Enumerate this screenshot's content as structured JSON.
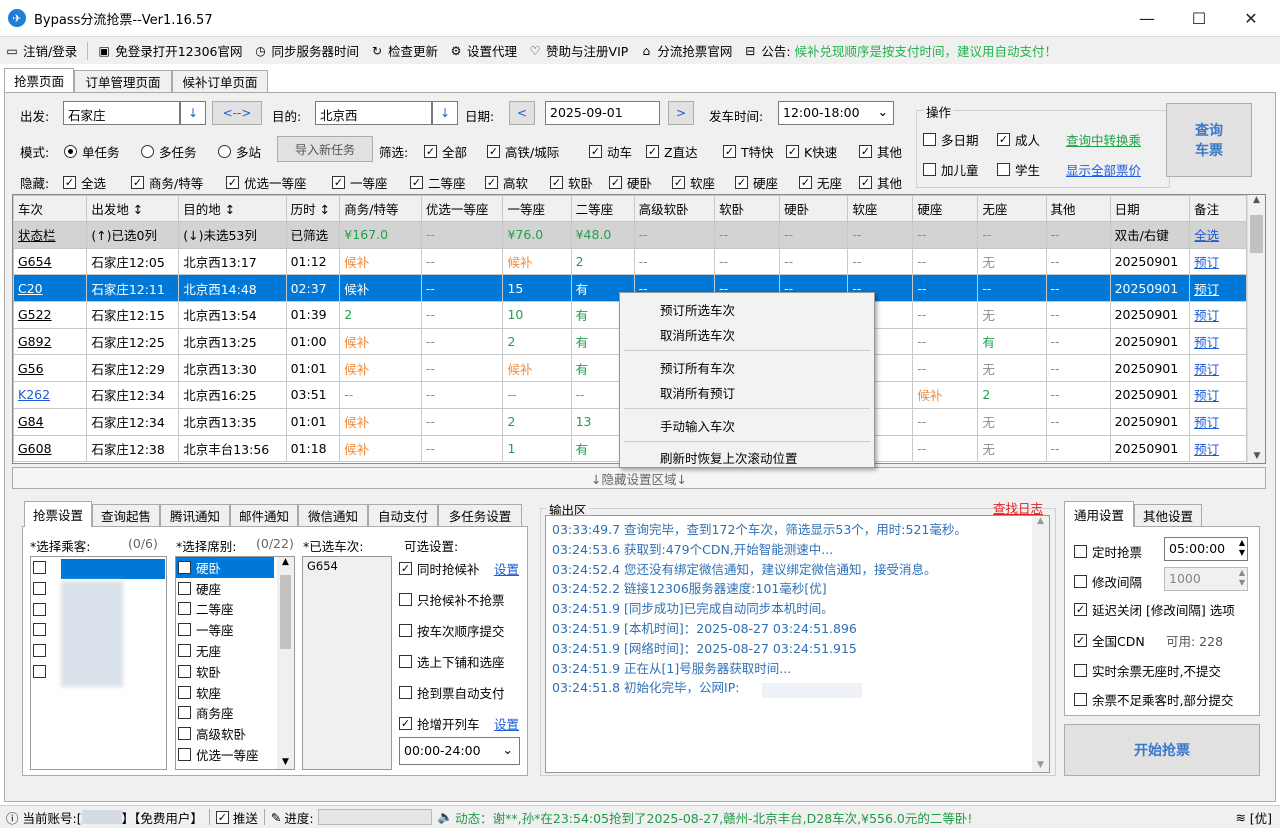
{
  "window": {
    "title": "Bypass分流抢票--Ver1.16.57"
  },
  "toolbar": {
    "items": [
      "注销/登录",
      "免登录打开12306官网",
      "同步服务器时间",
      "检查更新",
      "设置代理",
      "赞助与注册VIP",
      "分流抢票官网",
      "公告:"
    ],
    "notice": "候补兑现顺序是按支付时间，建议用自动支付！"
  },
  "main_tabs": [
    "抢票页面",
    "订单管理页面",
    "候补订单页面"
  ],
  "query": {
    "from_label": "出发:",
    "from_value": "石家庄",
    "swap_label": "<-->",
    "to_label": "目的:",
    "to_value": "北京西",
    "date_label": "日期:",
    "date_value": "2025-09-01",
    "prev": "<",
    "next": ">",
    "time_label": "发车时间:",
    "time_value": "12:00-18:00"
  },
  "ops": {
    "title": "操作",
    "multi_day": "多日期",
    "adult": "成人",
    "add_child": "加儿童",
    "student": "学生",
    "transfer_link": "查询中转换乘",
    "all_price_link": "显示全部票价",
    "query_btn_l1": "查询",
    "query_btn_l2": "车票"
  },
  "mode": {
    "label": "模式:",
    "single": "单任务",
    "multi": "多任务",
    "multi_station": "多站",
    "import_btn": "导入新任务"
  },
  "filter": {
    "label": "筛选:",
    "items": [
      "全部",
      "高铁/城际",
      "动车",
      "Z直达",
      "T特快",
      "K快速",
      "其他"
    ]
  },
  "hide": {
    "label": "隐藏:",
    "items": [
      "全选",
      "商务/特等",
      "优选一等座",
      "一等座",
      "二等座",
      "高软",
      "软卧",
      "硬卧",
      "软座",
      "硬座",
      "无座",
      "其他"
    ]
  },
  "grid": {
    "headers": [
      "车次",
      "出发地 ↕",
      "目的地 ↕",
      "历时 ↕",
      "商务/特等",
      "优选一等座",
      "一等座",
      "二等座",
      "高级软卧",
      "软卧",
      "硬卧",
      "软座",
      "硬座",
      "无座",
      "其他",
      "日期",
      "备注"
    ],
    "status_row": [
      "状态栏",
      "(↑)已选0列",
      "(↓)未选53列",
      "已筛选",
      "¥167.0",
      "--",
      "¥76.0",
      "¥48.0",
      "--",
      "--",
      "--",
      "--",
      "--",
      "--",
      "--",
      "双击/右键",
      "全选"
    ],
    "rows": [
      [
        "G654",
        "石家庄12:05",
        "北京西13:17",
        "01:12",
        "候补",
        "--",
        "候补",
        "2",
        "--",
        "--",
        "--",
        "--",
        "--",
        "无",
        "--",
        "20250901",
        "预订"
      ],
      [
        "C20",
        "石家庄12:11",
        "北京西14:48",
        "02:37",
        "候补",
        "--",
        "15",
        "有",
        "--",
        "--",
        "--",
        "--",
        "--",
        "--",
        "--",
        "20250901",
        "预订"
      ],
      [
        "G522",
        "石家庄12:15",
        "北京西13:54",
        "01:39",
        "2",
        "--",
        "10",
        "有",
        "--",
        "--",
        "--",
        "--",
        "--",
        "无",
        "--",
        "20250901",
        "预订"
      ],
      [
        "G892",
        "石家庄12:25",
        "北京西13:25",
        "01:00",
        "候补",
        "--",
        "2",
        "有",
        "--",
        "--",
        "--",
        "--",
        "--",
        "有",
        "--",
        "20250901",
        "预订"
      ],
      [
        "G56",
        "石家庄12:29",
        "北京西13:30",
        "01:01",
        "候补",
        "--",
        "候补",
        "有",
        "--",
        "--",
        "--",
        "--",
        "--",
        "无",
        "--",
        "20250901",
        "预订"
      ],
      [
        "K262",
        "石家庄12:34",
        "北京西16:25",
        "03:51",
        "--",
        "--",
        "--",
        "--",
        "--",
        "--",
        "--",
        "--",
        "候补",
        "2",
        "--",
        "20250901",
        "预订"
      ],
      [
        "G84",
        "石家庄12:34",
        "北京西13:35",
        "01:01",
        "候补",
        "--",
        "2",
        "13",
        "--",
        "--",
        "--",
        "--",
        "--",
        "无",
        "--",
        "20250901",
        "预订"
      ],
      [
        "G608",
        "石家庄12:38",
        "北京丰台13:56",
        "01:18",
        "候补",
        "--",
        "1",
        "有",
        "--",
        "--",
        "--",
        "--",
        "--",
        "无",
        "--",
        "20250901",
        "预订"
      ]
    ]
  },
  "context_menu": [
    "预订所选车次",
    "取消所选车次",
    "预订所有车次",
    "取消所有预订",
    "手动输入车次",
    "刷新时恢复上次滚动位置"
  ],
  "hide_bar": "↓隐藏设置区域↓",
  "settings_tabs": [
    "抢票设置",
    "查询起售",
    "腾讯通知",
    "邮件通知",
    "微信通知",
    "自动支付",
    "多任务设置"
  ],
  "passengers": {
    "label": "*选择乘客:",
    "count": "(0/6)"
  },
  "seats": {
    "label": "*选择席别:",
    "count": "(0/22)",
    "items": [
      "硬卧",
      "硬座",
      "二等座",
      "一等座",
      "无座",
      "软卧",
      "软座",
      "商务座",
      "高级软卧",
      "优选一等座"
    ]
  },
  "selected_trains": {
    "label": "*已选车次:",
    "items": [
      "G654"
    ]
  },
  "options": {
    "label": "可选设置:",
    "items": [
      "同时抢候补",
      "只抢候补不抢票",
      "按车次顺序提交",
      "选上下铺和选座",
      "抢到票自动支付",
      "抢增开列车"
    ],
    "set_link": "设置",
    "time_range": "00:00-24:00"
  },
  "output": {
    "title": "输出区",
    "find_log": "查找日志",
    "lines": [
      "03:33:49.7  查询完毕，查到172个车次，筛选显示53个，用时:521毫秒。",
      "03:24:53.6  获取到:479个CDN,开始智能测速中...",
      "03:24:52.4  您还没有绑定微信通知，建议绑定微信通知，接受消息。",
      "03:24:52.2  链接12306服务器速度:101毫秒[优]",
      "03:24:51.9  [同步成功]已完成自动同步本机时间。",
      "03:24:51.9  [本机时间]：2025-08-27 03:24:51.896",
      "03:24:51.9  [网络时间]：2025-08-27 03:24:51.915",
      "03:24:51.9  正在从[1]号服务器获取时间...",
      "03:24:51.8  初始化完毕，公网IP:"
    ]
  },
  "general": {
    "tabs": [
      "通用设置",
      "其他设置"
    ],
    "timed": "定时抢票",
    "timed_value": "05:00:00",
    "interval": "修改间隔",
    "interval_value": "1000",
    "delay": "延迟关闭 [修改间隔] 选项",
    "cdn": "全国CDN",
    "cdn_avail": "可用: 228",
    "realtime": "实时余票无座时,不提交",
    "insufficient": "余票不足乘客时,部分提交",
    "start_btn": "开始抢票"
  },
  "statusbar": {
    "account_label": "当前账号:[",
    "account_type": "】【免费用户】",
    "push": "推送",
    "progress": "进度:",
    "news": "动态：谢**,孙*在23:54:05抢到了2025-08-27,赣州-北京丰台,D28车次,¥556.0元的二等卧!",
    "signal": "[优]"
  }
}
